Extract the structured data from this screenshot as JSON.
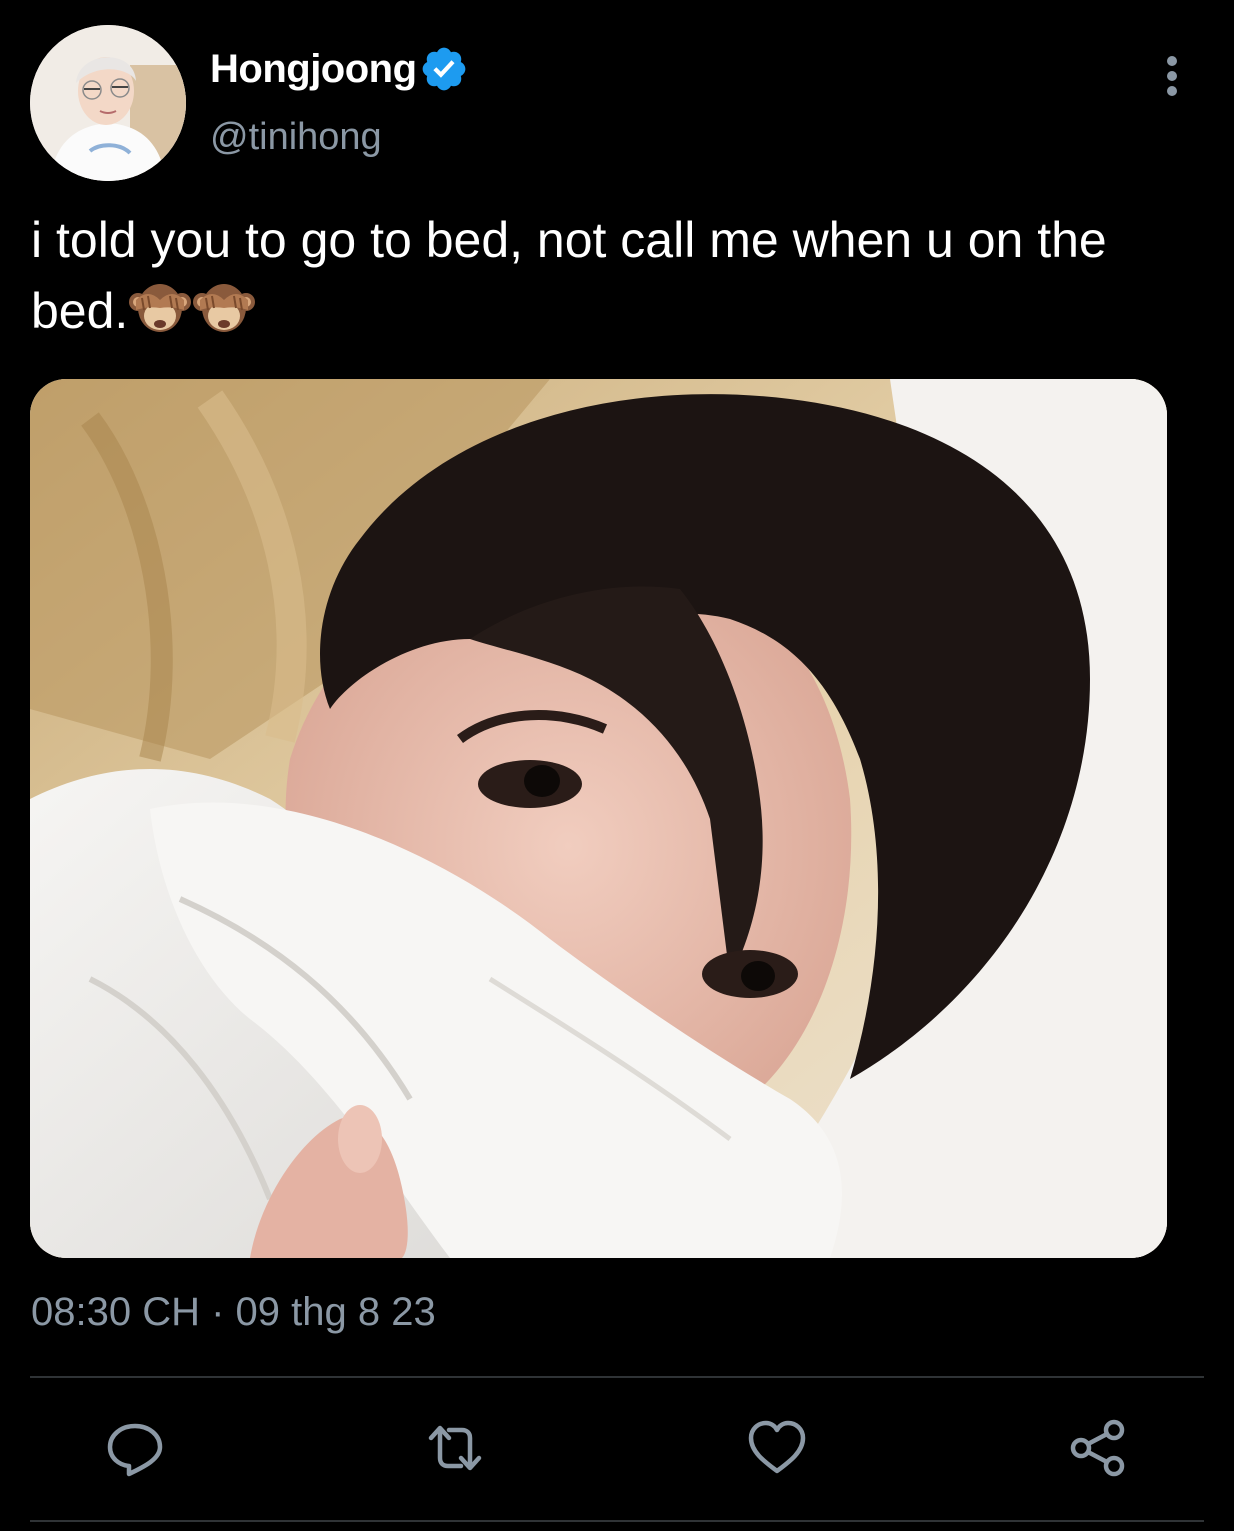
{
  "colors": {
    "background": "#000000",
    "text_primary": "#ffffff",
    "text_secondary": "#8b98a5",
    "verified_blue": "#1d9bf0",
    "divider": "#2f3336",
    "action_icon": "#8b98a5"
  },
  "tweet": {
    "author": {
      "display_name": "Hongjoong",
      "handle": "@tinihong",
      "verified": true
    },
    "text": "i told you to go to bed, not call me when u on the bed.",
    "text_emojis": [
      "see-no-evil-monkey",
      "see-no-evil-monkey"
    ],
    "timestamp": "08:30 CH · 09 thg 8 23"
  },
  "icons": {
    "more": "more-vertical-icon",
    "verified": "verified-badge-icon",
    "reply": "reply-icon",
    "retweet": "retweet-icon",
    "like": "heart-icon",
    "share": "share-icon"
  }
}
